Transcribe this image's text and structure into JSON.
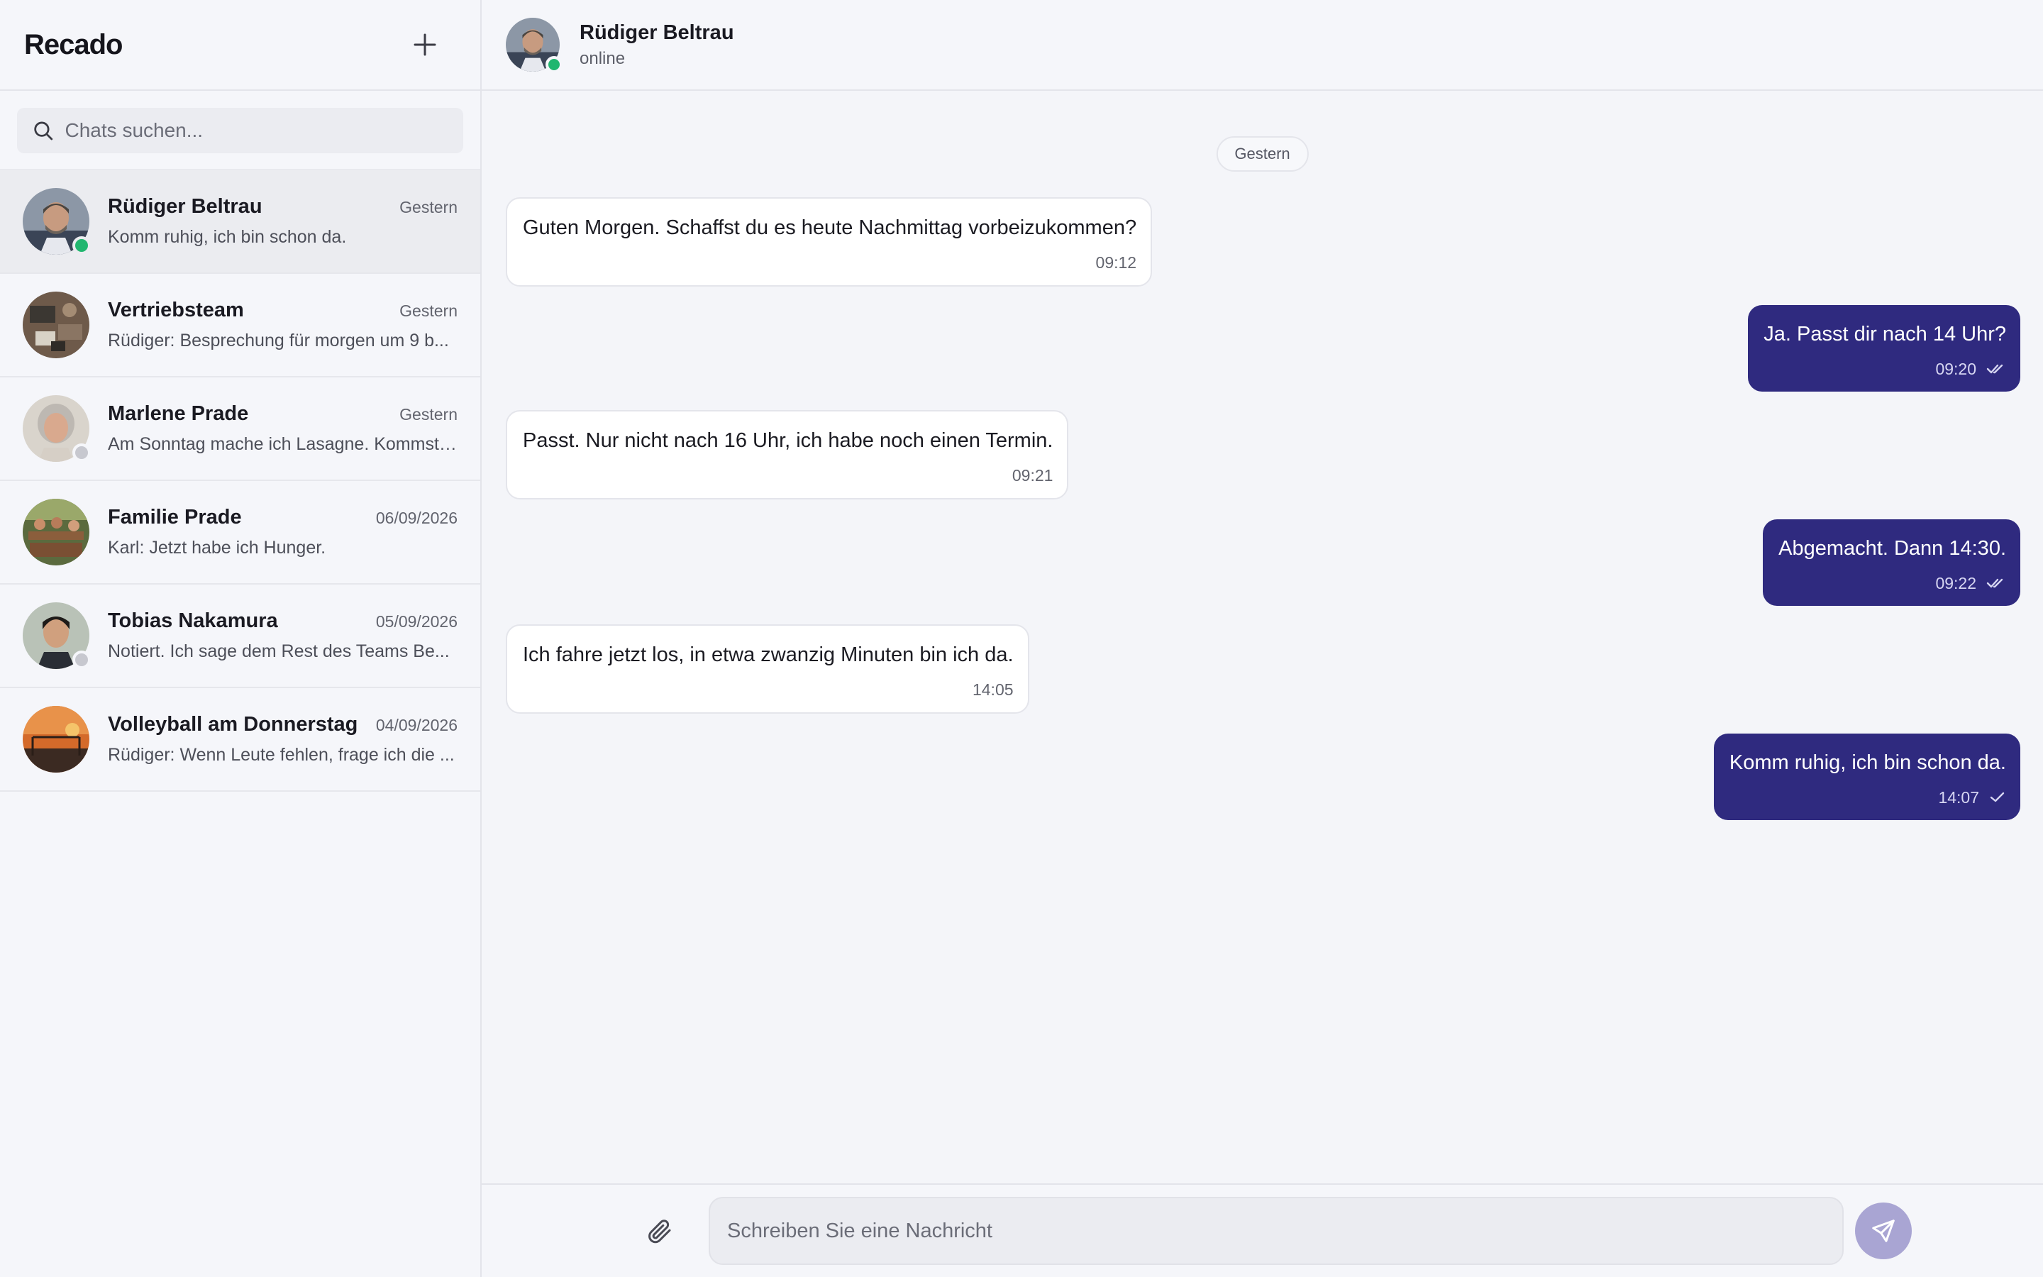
{
  "app": {
    "title": "Recado"
  },
  "search": {
    "placeholder": "Chats suchen..."
  },
  "chats": [
    {
      "name": "Rüdiger Beltrau",
      "time": "Gestern",
      "preview": "Komm ruhig, ich bin schon da.",
      "presence": "online"
    },
    {
      "name": "Vertriebsteam",
      "time": "Gestern",
      "preview": "Rüdiger: Besprechung für morgen um 9 b...",
      "presence": "none"
    },
    {
      "name": "Marlene Prade",
      "time": "Gestern",
      "preview": "Am Sonntag mache ich Lasagne. Kommst ...",
      "presence": "offline"
    },
    {
      "name": "Familie Prade",
      "time": "06/09/2026",
      "preview": "Karl: Jetzt habe ich Hunger.",
      "presence": "none"
    },
    {
      "name": "Tobias Nakamura",
      "time": "05/09/2026",
      "preview": "Notiert. Ich sage dem Rest des Teams Be...",
      "presence": "offline"
    },
    {
      "name": "Volleyball am Donnerstag",
      "time": "04/09/2026",
      "preview": "Rüdiger: Wenn Leute fehlen, frage ich die ...",
      "presence": "none"
    }
  ],
  "conversation": {
    "name": "Rüdiger Beltrau",
    "status": "online",
    "date_separator": "Gestern",
    "messages": [
      {
        "direction": "in",
        "text": "Guten Morgen. Schaffst du es heute Nachmittag vorbeizukommen?",
        "time": "09:12"
      },
      {
        "direction": "out",
        "text": "Ja. Passt dir nach 14 Uhr?",
        "time": "09:20",
        "receipt": "read"
      },
      {
        "direction": "in",
        "text": "Passt. Nur nicht nach 16 Uhr, ich habe noch einen Termin.",
        "time": "09:21"
      },
      {
        "direction": "out",
        "text": "Abgemacht. Dann 14:30.",
        "time": "09:22",
        "receipt": "read"
      },
      {
        "direction": "in",
        "text": "Ich fahre jetzt los, in etwa zwanzig Minuten bin ich da.",
        "time": "14:05"
      },
      {
        "direction": "out",
        "text": "Komm ruhig, ich bin schon da.",
        "time": "14:07",
        "receipt": "sent"
      }
    ]
  },
  "composer": {
    "placeholder": "Schreiben Sie eine Nachricht"
  },
  "icons": {
    "new_chat": "plus-icon",
    "search": "search-icon",
    "attach": "paperclip-icon",
    "send": "send-icon",
    "read": "double-check-icon",
    "sent": "check-icon"
  },
  "colors": {
    "accent": "#2f2a7f",
    "online": "#21b66f",
    "offline": "#c7c8cf",
    "send_button": "#a9a5d3"
  }
}
